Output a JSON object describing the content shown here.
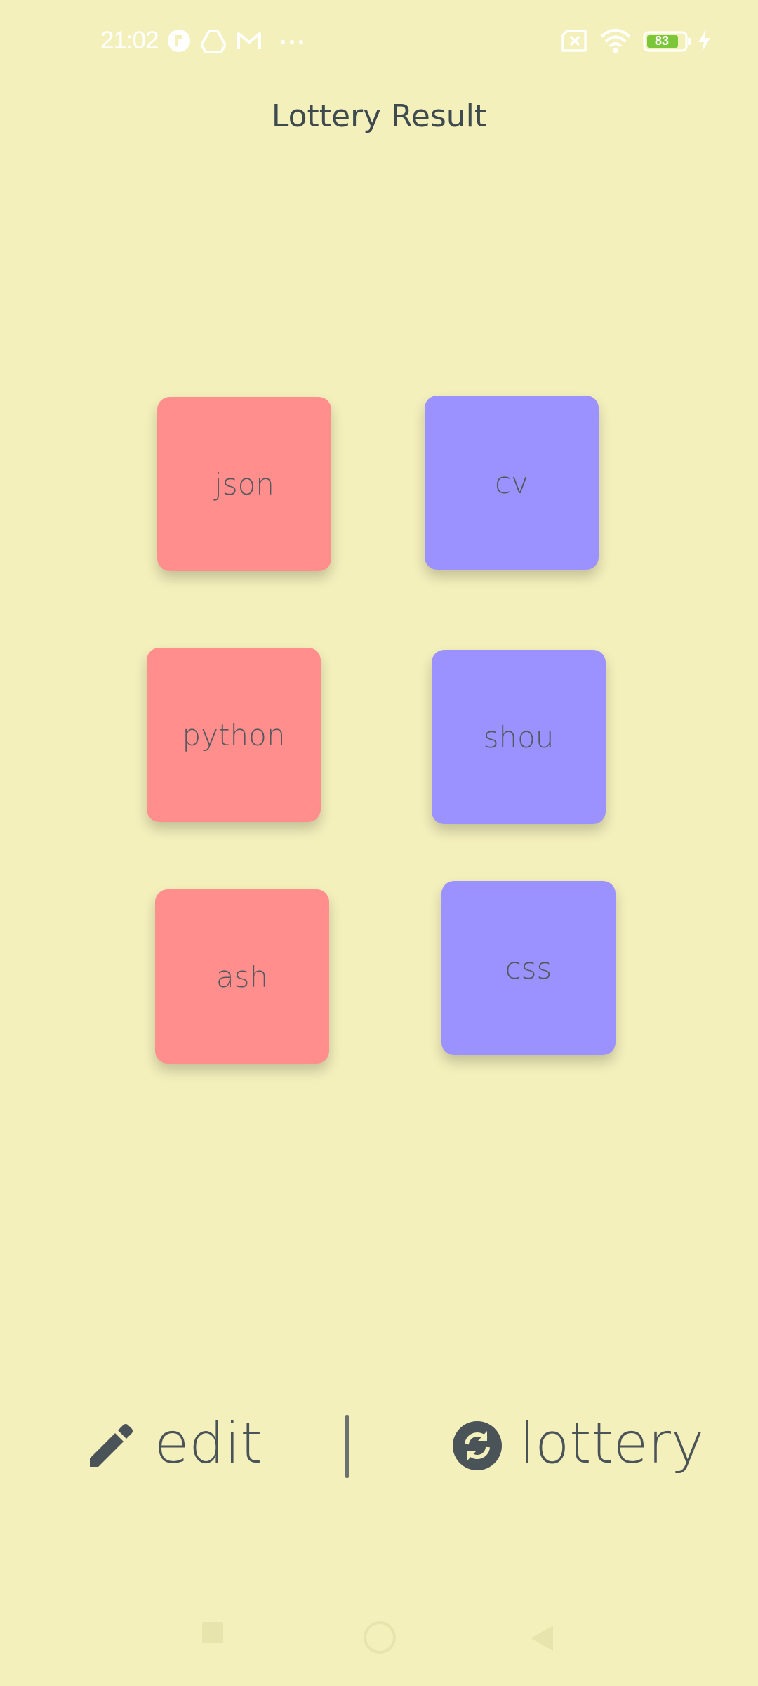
{
  "status_bar": {
    "time": "21:02",
    "battery_level": "83",
    "icons_left": [
      "notification-r-icon",
      "drive-icon",
      "gmail-icon",
      "more-dots-icon"
    ],
    "icons_right": [
      "no-sim-icon",
      "wifi-icon",
      "battery-icon",
      "charging-icon"
    ]
  },
  "header": {
    "title": "Lottery Result"
  },
  "cards": [
    {
      "label": "json",
      "color": "#ff8e8c"
    },
    {
      "label": "cv",
      "color": "#9b92ff"
    },
    {
      "label": "python",
      "color": "#ff8e8c"
    },
    {
      "label": "shou",
      "color": "#9b92ff"
    },
    {
      "label": "ash",
      "color": "#ff8e8c"
    },
    {
      "label": "css",
      "color": "#9b92ff"
    }
  ],
  "actions": {
    "edit_label": "edit",
    "lottery_label": "lottery"
  },
  "colors": {
    "background": "#f4f0bc",
    "text": "#4a5358",
    "red_card": "#ff8e8c",
    "blue_card": "#9b92ff"
  },
  "nav_bar": {
    "items": [
      "recents-square-icon",
      "home-circle-icon",
      "back-triangle-icon"
    ]
  }
}
